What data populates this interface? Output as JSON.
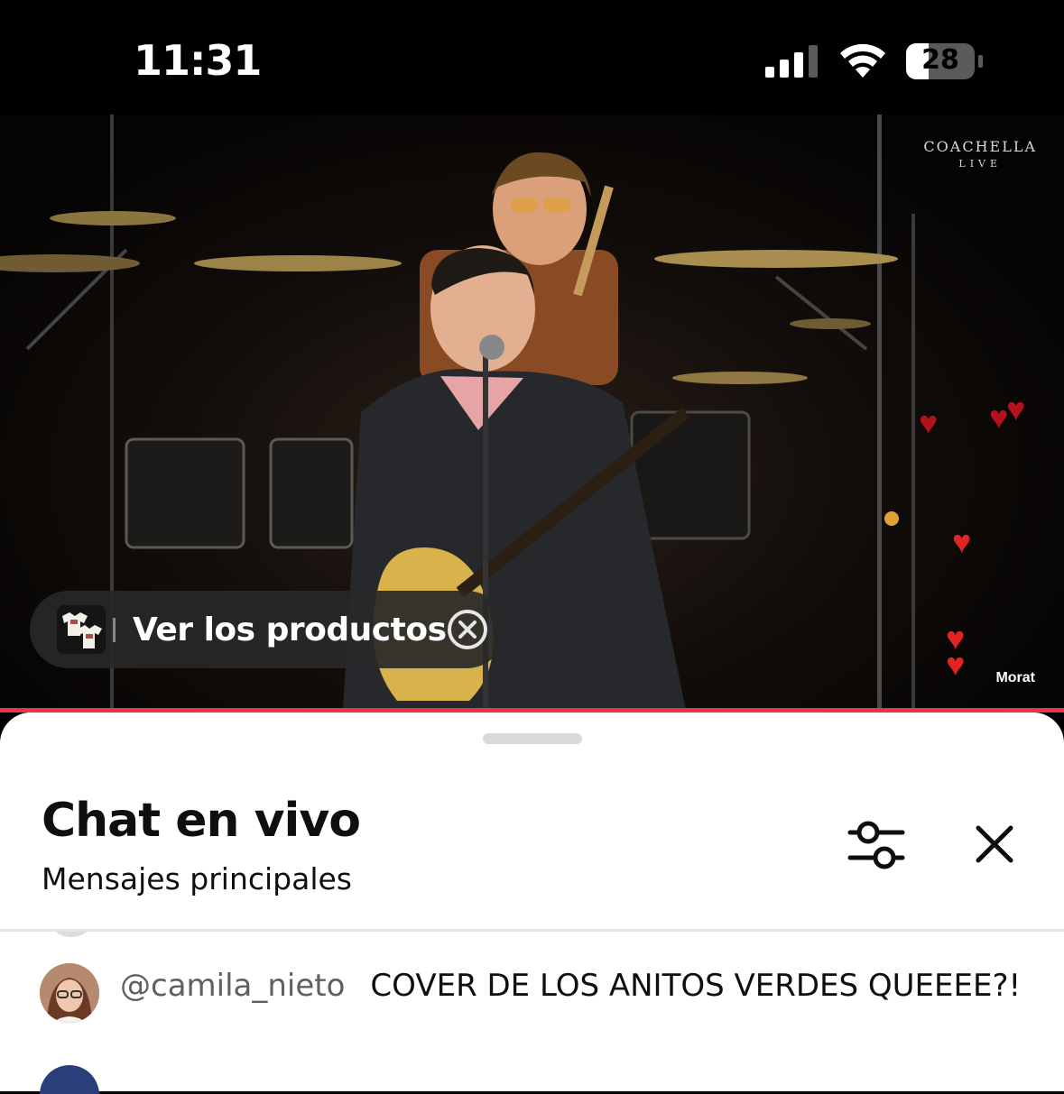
{
  "status_bar": {
    "time": "11:31",
    "battery": "28"
  },
  "video": {
    "logo_title": "COACHELLA",
    "logo_subtitle": "LIVE",
    "channel_watermark": "Morat",
    "products_label": "Ver los productos",
    "progress_color": "#e8334a"
  },
  "chat": {
    "title": "Chat en vivo",
    "subtitle": "Mensajes principales",
    "messages": [
      {
        "author": "@camila_nieto",
        "text": "COVER DE LOS ANITOS VERDES QUEEEE?!"
      }
    ]
  },
  "colors": {
    "accent": "#e8334a",
    "heart": "#e02424"
  }
}
